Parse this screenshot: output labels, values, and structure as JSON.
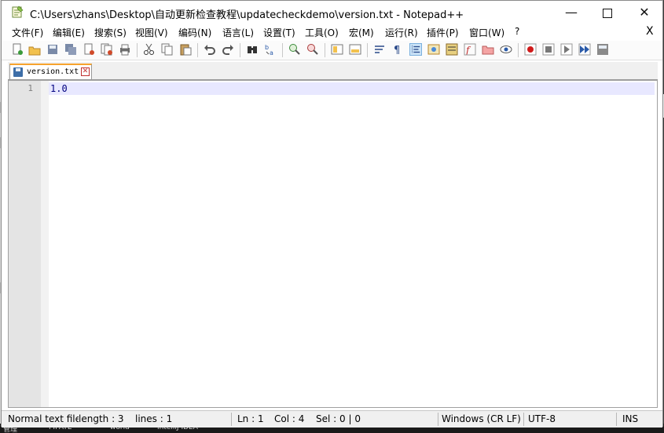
{
  "window": {
    "title": "C:\\Users\\zhans\\Desktop\\自动更新检查教程\\updatecheckdemo\\version.txt - Notepad++",
    "minimize_glyph": "—",
    "close_glyph": "✕"
  },
  "menu": {
    "items": [
      "文件(F)",
      "编辑(E)",
      "搜索(S)",
      "视图(V)",
      "编码(N)",
      "语言(L)",
      "设置(T)",
      "工具(O)",
      "宏(M)",
      "运行(R)",
      "插件(P)",
      "窗口(W)",
      "?"
    ],
    "close_doc": "X"
  },
  "toolbar": {
    "icons": [
      "new-file-icon",
      "open-file-icon",
      "save-icon",
      "save-all-icon",
      "close-icon",
      "close-all-icon",
      "print-icon",
      "cut-icon",
      "copy-icon",
      "paste-icon",
      "undo-icon",
      "redo-icon",
      "find-icon",
      "replace-icon",
      "zoom-in-icon",
      "zoom-out-icon",
      "sync-vertical-icon",
      "sync-horizontal-icon",
      "word-wrap-icon",
      "show-all-chars-icon",
      "indent-guide-icon",
      "document-map-icon",
      "function-list-icon",
      "folder-workspace-icon",
      "monitor-icon",
      "eye-icon",
      "record-macro-icon",
      "stop-macro-icon",
      "play-macro-icon",
      "run-macro-multiple-icon",
      "save-macro-icon"
    ]
  },
  "tab": {
    "label": "version.txt"
  },
  "editor": {
    "lines": [
      {
        "number": "1",
        "text": "1.0"
      }
    ]
  },
  "status": {
    "doc_type": "Normal text file",
    "length": "length : 3",
    "lines": "lines : 1",
    "ln": "Ln : 1",
    "col": "Col : 4",
    "sel": "Sel : 0 | 0",
    "eol": "Windows (CR LF)",
    "encoding": "UTF-8",
    "mode": "INS"
  },
  "taskbar": {
    "items": [
      "管理",
      "PIPATE",
      "world",
      "IntelliJ IDEA"
    ]
  },
  "colors": {
    "tab_accent": "#f7a32d",
    "current_line": "#e8e8ff",
    "code_text": "#000080",
    "gutter": "#e4e4e4"
  }
}
